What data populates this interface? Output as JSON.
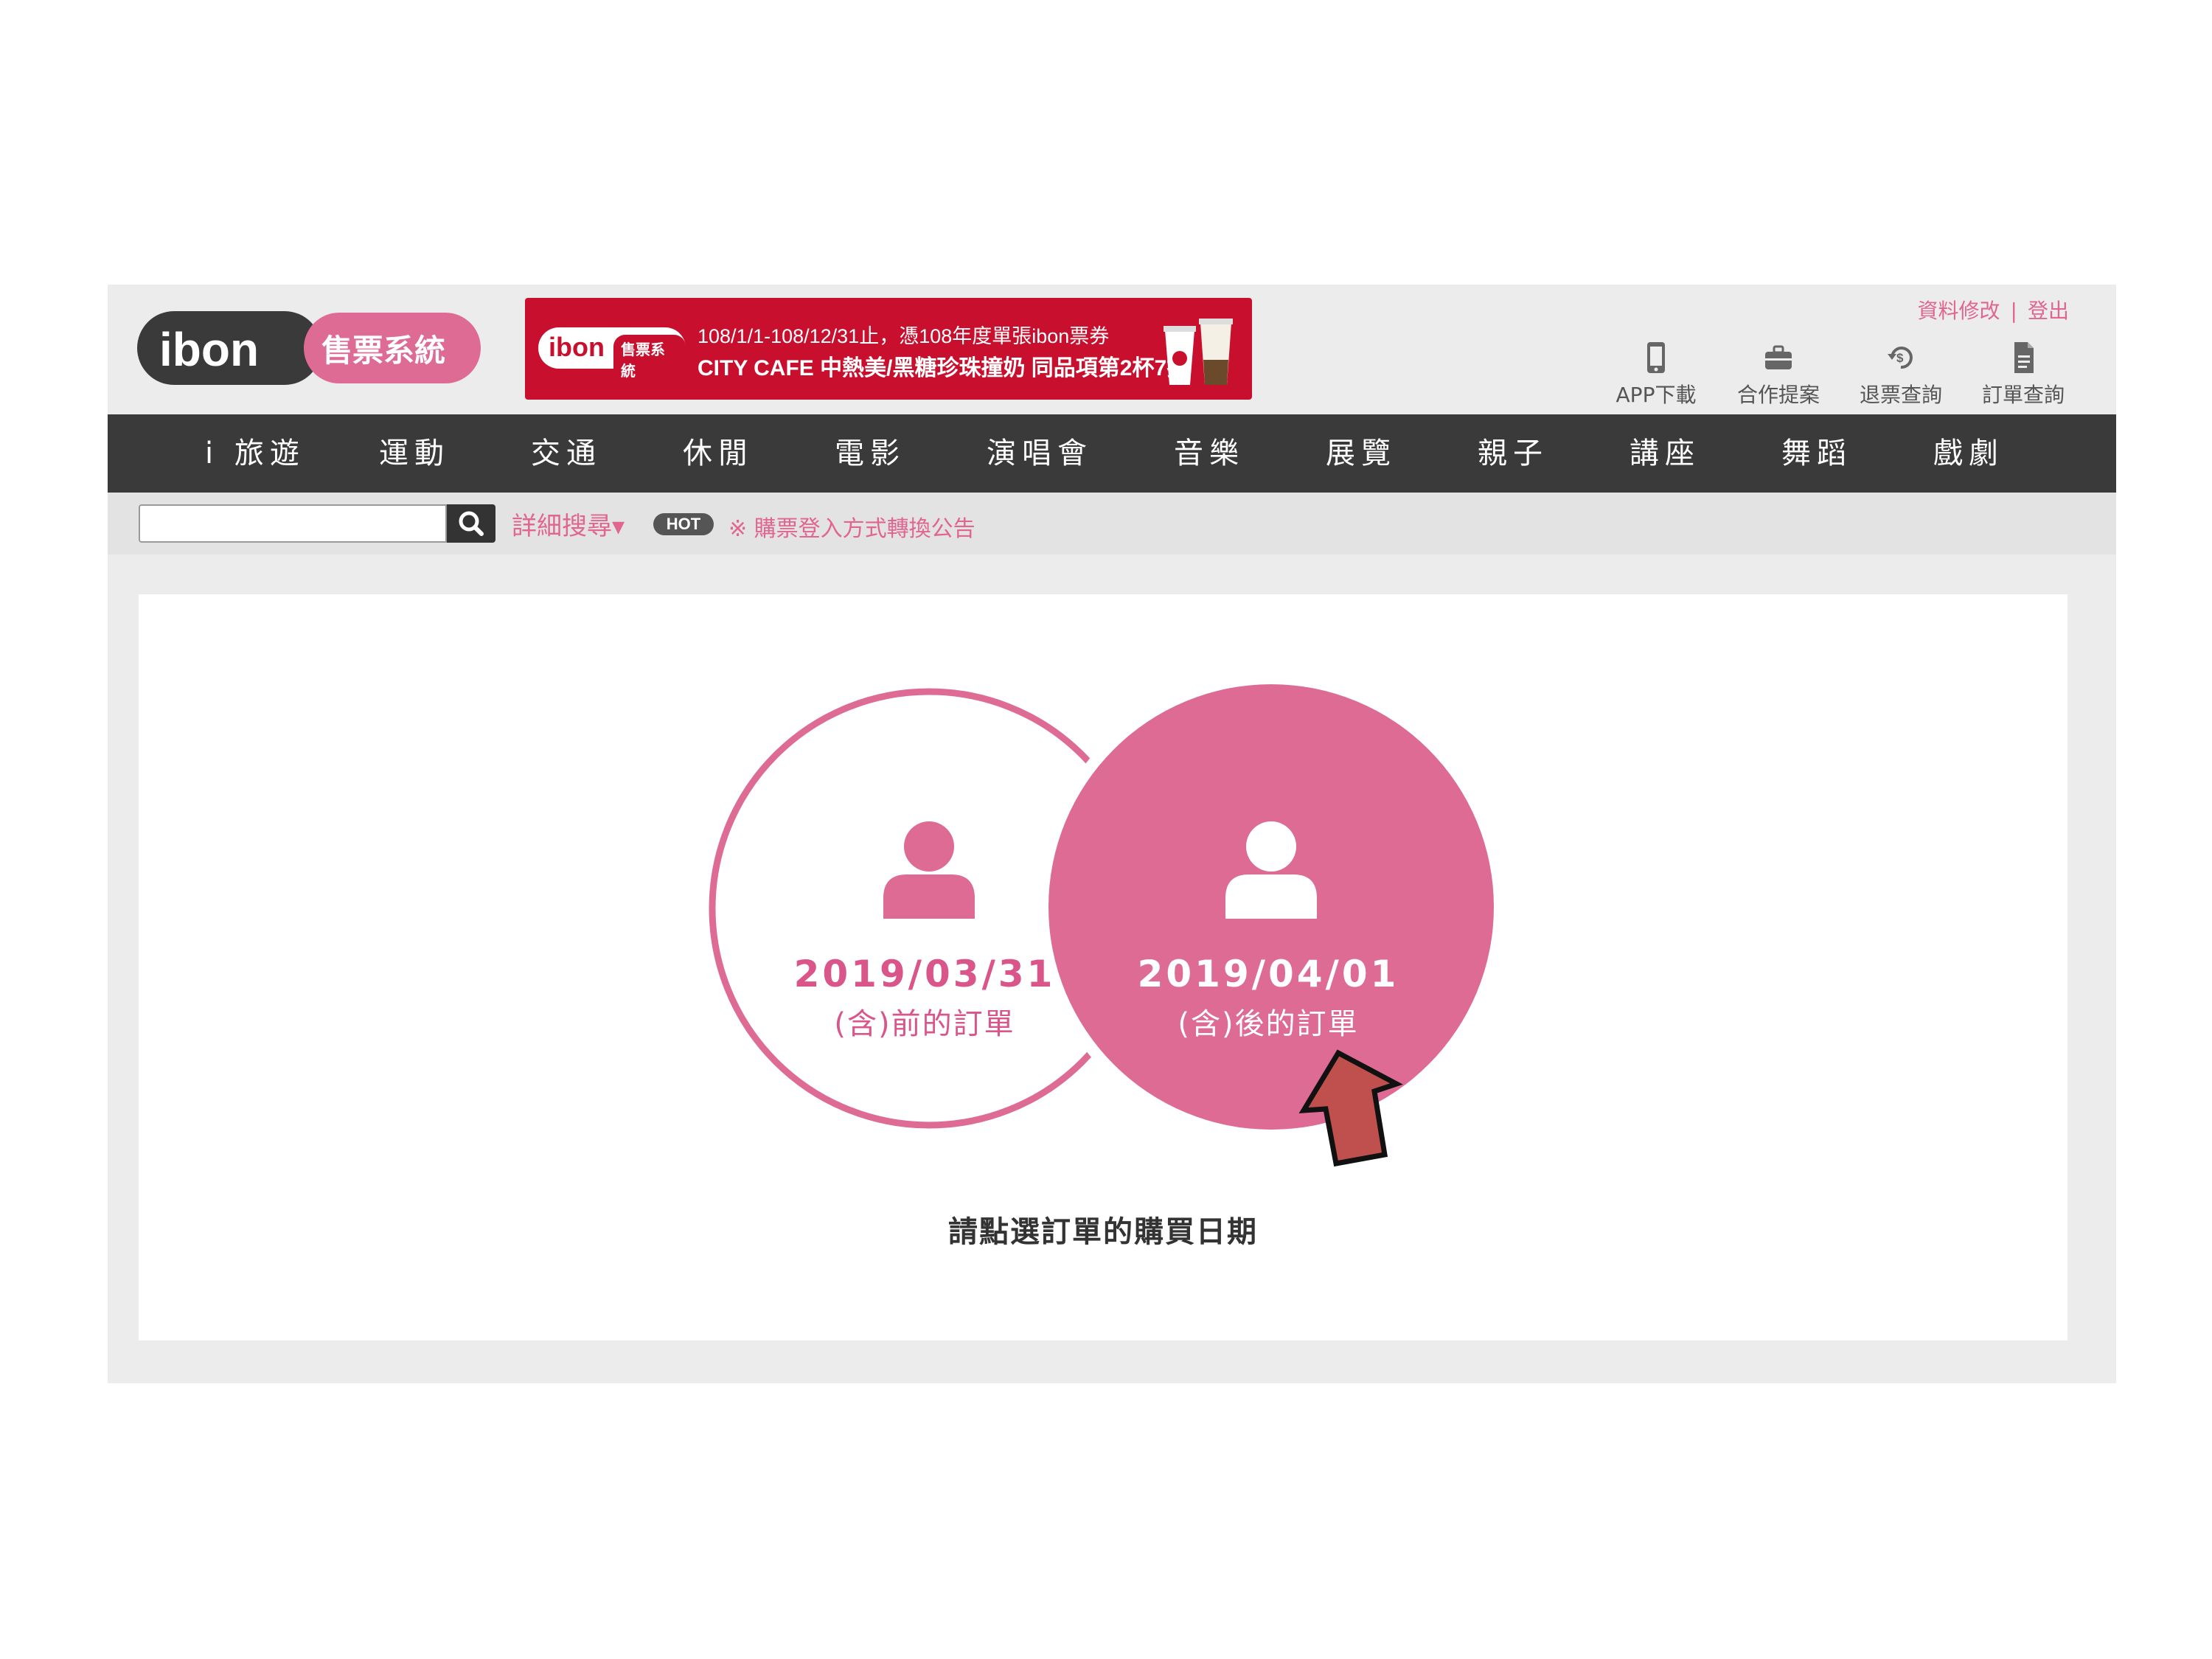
{
  "brand": {
    "logo_text": "ibon",
    "logo_subtitle": "售票系統"
  },
  "banner": {
    "badge_logo": "ibon",
    "badge_sub": "售票系統",
    "line1": "108/1/1-108/12/31止，憑108年度單張ibon票券",
    "line2": "CITY CAFE 中熱美/黑糖珍珠撞奶 同品項第2杯7折"
  },
  "user_links": {
    "edit_profile": "資料修改",
    "separator": "|",
    "logout": "登出"
  },
  "quick_links": [
    {
      "label": "APP下載",
      "icon": "phone-icon"
    },
    {
      "label": "合作提案",
      "icon": "briefcase-icon"
    },
    {
      "label": "退票查詢",
      "icon": "refund-icon"
    },
    {
      "label": "訂單查詢",
      "icon": "document-icon"
    }
  ],
  "nav": [
    "i 旅遊",
    "運動",
    "交通",
    "休閒",
    "電影",
    "演唱會",
    "音樂",
    "展覽",
    "親子",
    "講座",
    "舞蹈",
    "戲劇"
  ],
  "search": {
    "placeholder": "",
    "advanced_label": "詳細搜尋▾",
    "hot_badge": "HOT",
    "notice": "※ 購票登入方式轉換公告"
  },
  "order_options": {
    "before": {
      "date": "2019/03/31",
      "label": "(含)前的訂單"
    },
    "after": {
      "date": "2019/04/01",
      "label": "(含)後的訂單"
    }
  },
  "instruction": "請點選訂單的購買日期",
  "colors": {
    "brand_pink": "#d9558a",
    "pink_fill": "#de6b94",
    "nav_bg": "#3a3a3a",
    "banner_red": "#c8102e",
    "arrow_red": "#c0504d"
  }
}
